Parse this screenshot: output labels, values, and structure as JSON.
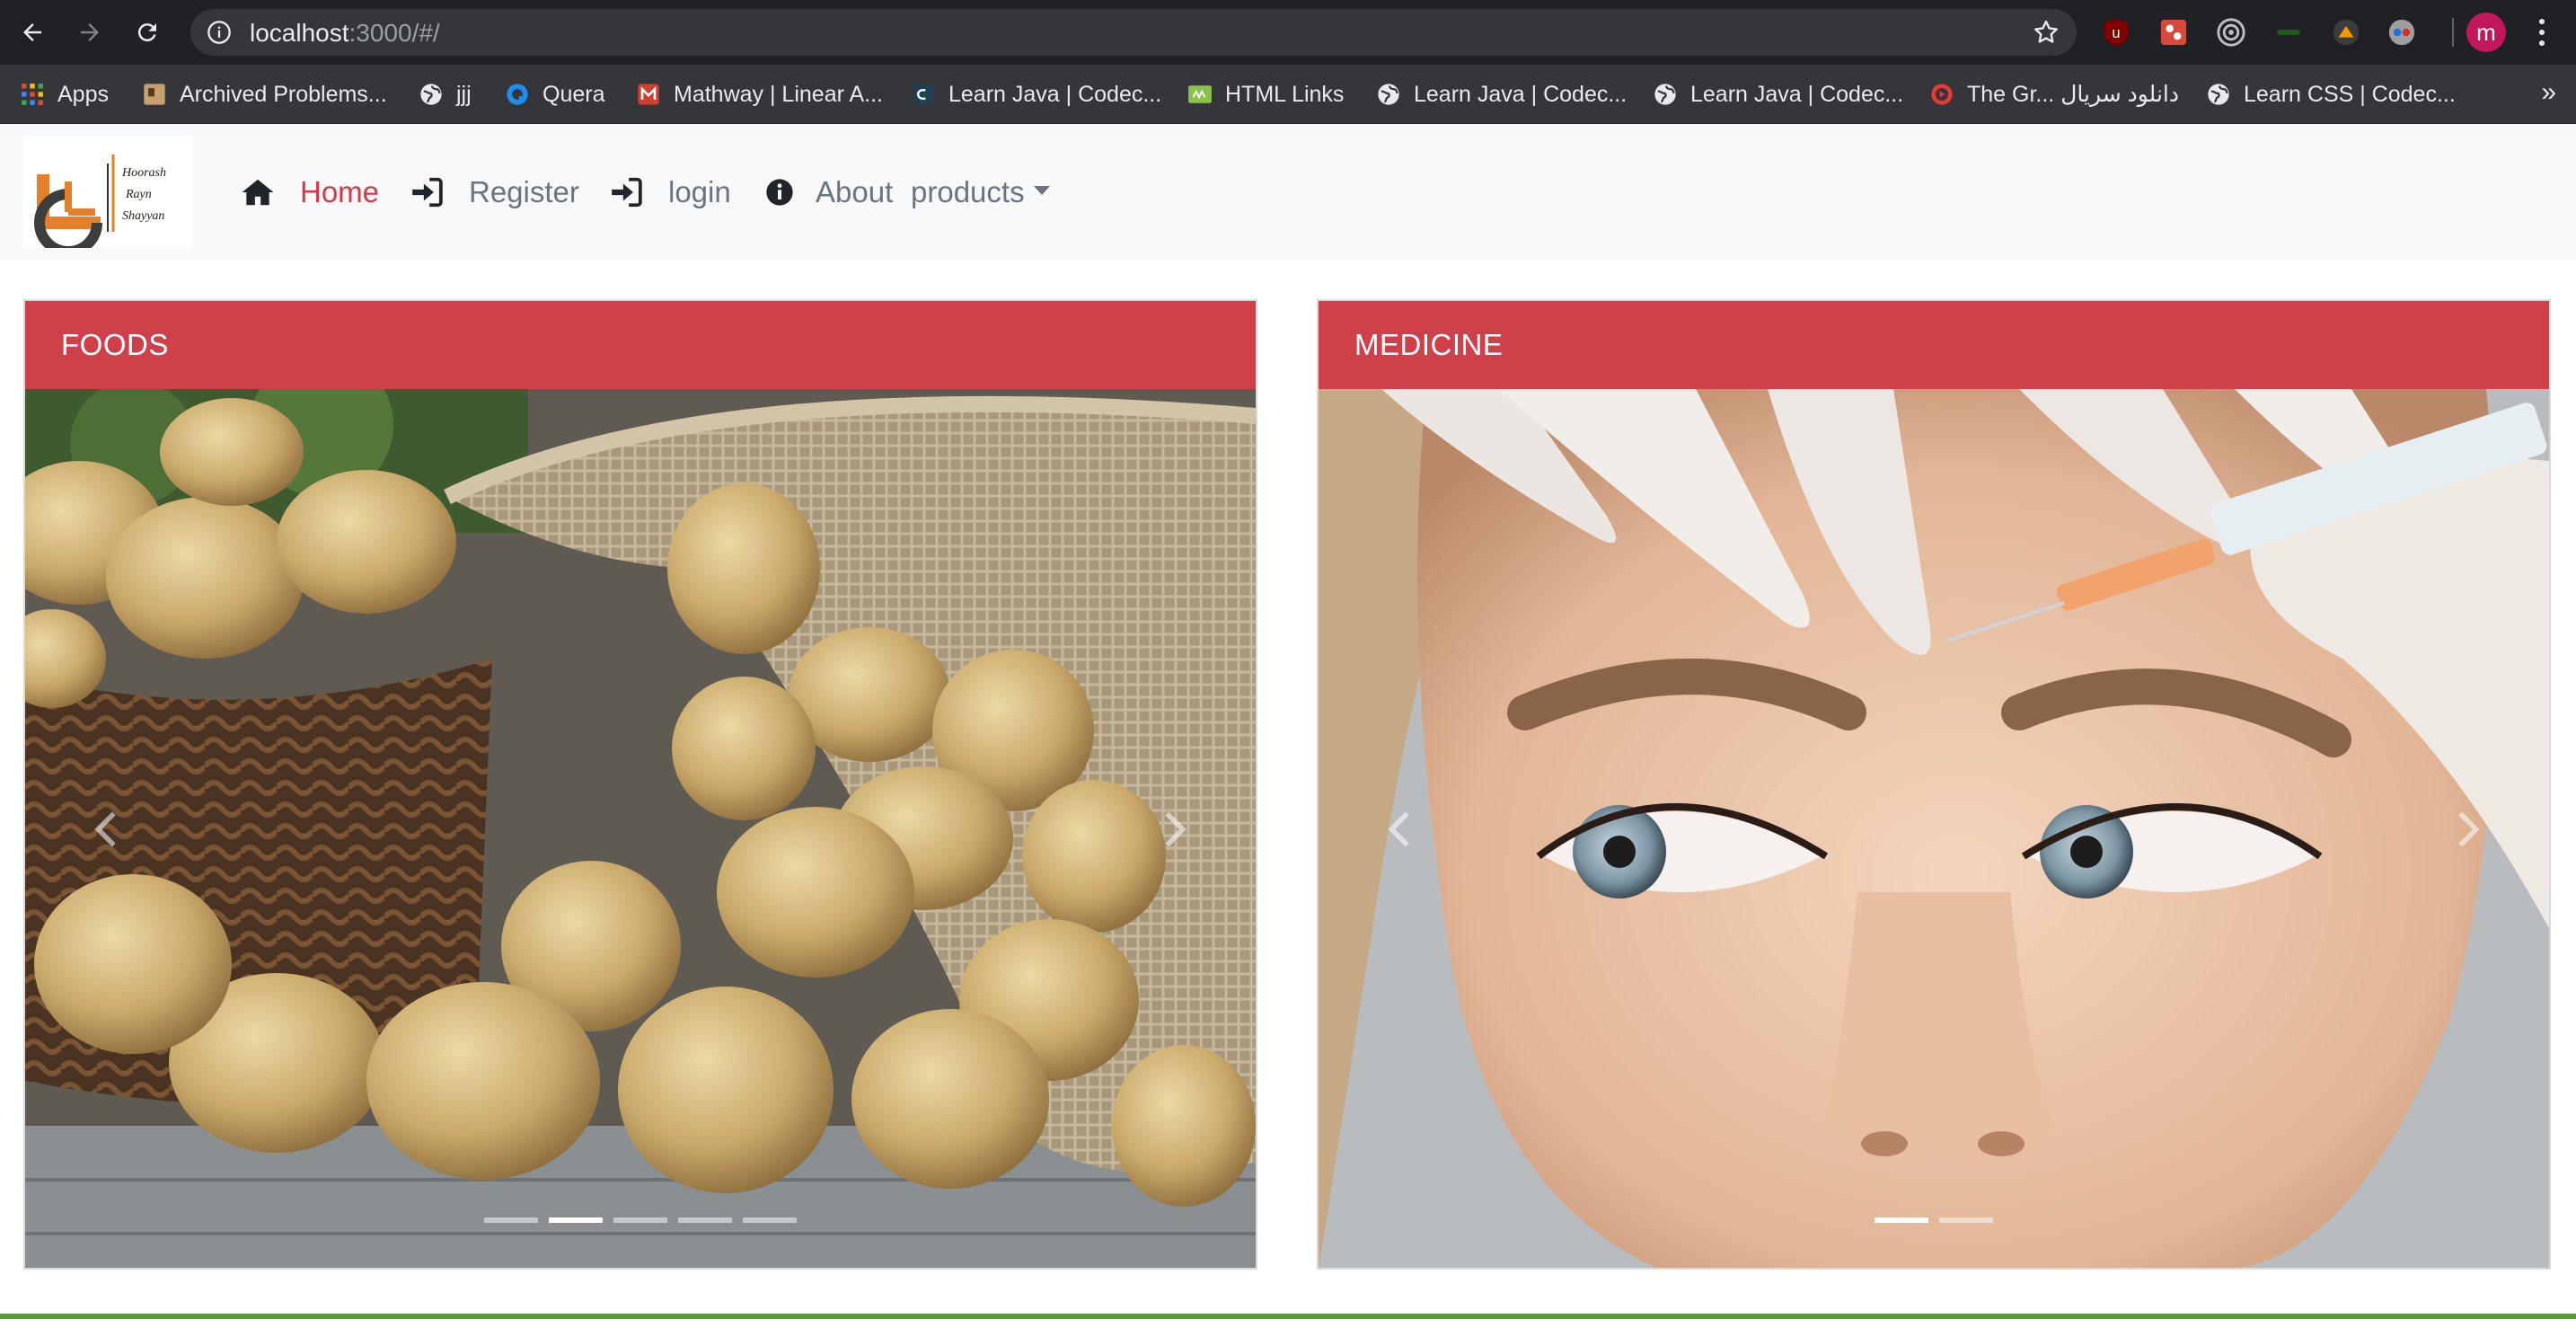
{
  "browser": {
    "url_host": "localhost",
    "url_rest": ":3000/#/",
    "avatar_letter": "m",
    "icons": [
      "back-icon",
      "forward-icon",
      "reload-icon",
      "info-icon",
      "star-icon"
    ],
    "bookmarks": [
      {
        "label": "Apps",
        "icon": "apps-grid-icon"
      },
      {
        "label": "Archived Problems...",
        "icon": "bookmark-favicon"
      },
      {
        "label": "jjj",
        "icon": "globe-icon"
      },
      {
        "label": "Quera",
        "icon": "quera-icon"
      },
      {
        "label": "Mathway | Linear A...",
        "icon": "mathway-icon"
      },
      {
        "label": "Learn Java | Codec...",
        "icon": "codecademy-icon"
      },
      {
        "label": "HTML Links",
        "icon": "html-links-icon"
      },
      {
        "label": "Learn Java | Codec...",
        "icon": "globe-icon"
      },
      {
        "label": "Learn Java | Codec...",
        "icon": "globe-icon"
      },
      {
        "label": "The Gr... دانلود سریال",
        "icon": "play-icon"
      },
      {
        "label": "Learn CSS | Codec...",
        "icon": "globe-icon"
      }
    ],
    "more_label": "»"
  },
  "navbar": {
    "logo_lines": [
      "Hoorash",
      "Rayn",
      "Shayyan"
    ],
    "items": [
      {
        "label": "Home",
        "icon": "home-icon",
        "active": true
      },
      {
        "label": "Register",
        "icon": "sign-in-icon"
      },
      {
        "label": "login",
        "icon": "sign-in-icon"
      },
      {
        "label": "About",
        "icon": "info-circle-icon"
      },
      {
        "label": "products",
        "icon": "caret-down-icon"
      }
    ]
  },
  "cards": [
    {
      "title": "FOODS",
      "slides": 5,
      "active_slide": 2
    },
    {
      "title": "MEDICINE",
      "slides": 2,
      "active_slide": 1
    }
  ],
  "colors": {
    "accent": "#dc3545",
    "card_header": "#d0404b",
    "navbar_bg": "#f8f9fa",
    "chrome_bg": "#202124"
  }
}
